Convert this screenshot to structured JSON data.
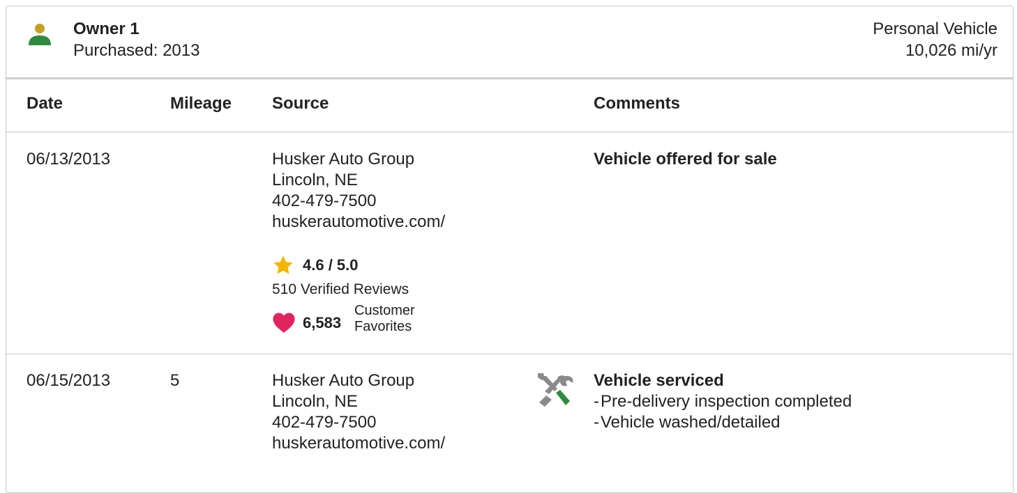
{
  "owner": {
    "name": "Owner 1",
    "purchased": "Purchased: 2013",
    "usage_type": "Personal Vehicle",
    "miles_per_year": "10,026 mi/yr",
    "icon": "person-icon",
    "icon_colors": {
      "head": "#c6a020",
      "body": "#2e8b3e"
    }
  },
  "table": {
    "headers": {
      "date": "Date",
      "mileage": "Mileage",
      "source": "Source",
      "comments": "Comments"
    },
    "rows": [
      {
        "date": "06/13/2013",
        "mileage": "",
        "source": {
          "name": "Husker Auto Group",
          "location": "Lincoln, NE",
          "phone": "402-479-7500",
          "website": "huskerautomotive.com/",
          "rating": "4.6 / 5.0",
          "reviews": "510 Verified Reviews",
          "favorites_count": "6,583",
          "favorites_label_1": "Customer",
          "favorites_label_2": "Favorites"
        },
        "comment_title": "Vehicle offered for sale",
        "comment_details": []
      },
      {
        "date": "06/15/2013",
        "mileage": "5",
        "source": {
          "name": "Husker Auto Group",
          "location": "Lincoln, NE",
          "phone": "402-479-7500",
          "website": "huskerautomotive.com/"
        },
        "comment_icon": "tools-icon",
        "comment_title": "Vehicle serviced",
        "comment_details": [
          "Pre-delivery inspection completed",
          "Vehicle washed/detailed"
        ]
      }
    ]
  },
  "colors": {
    "star": "#f4b400",
    "heart": "#e0245e",
    "tool_handle": "#2e8b3e",
    "tool_metal": "#8a8a8a",
    "border": "#c8c8c8"
  }
}
